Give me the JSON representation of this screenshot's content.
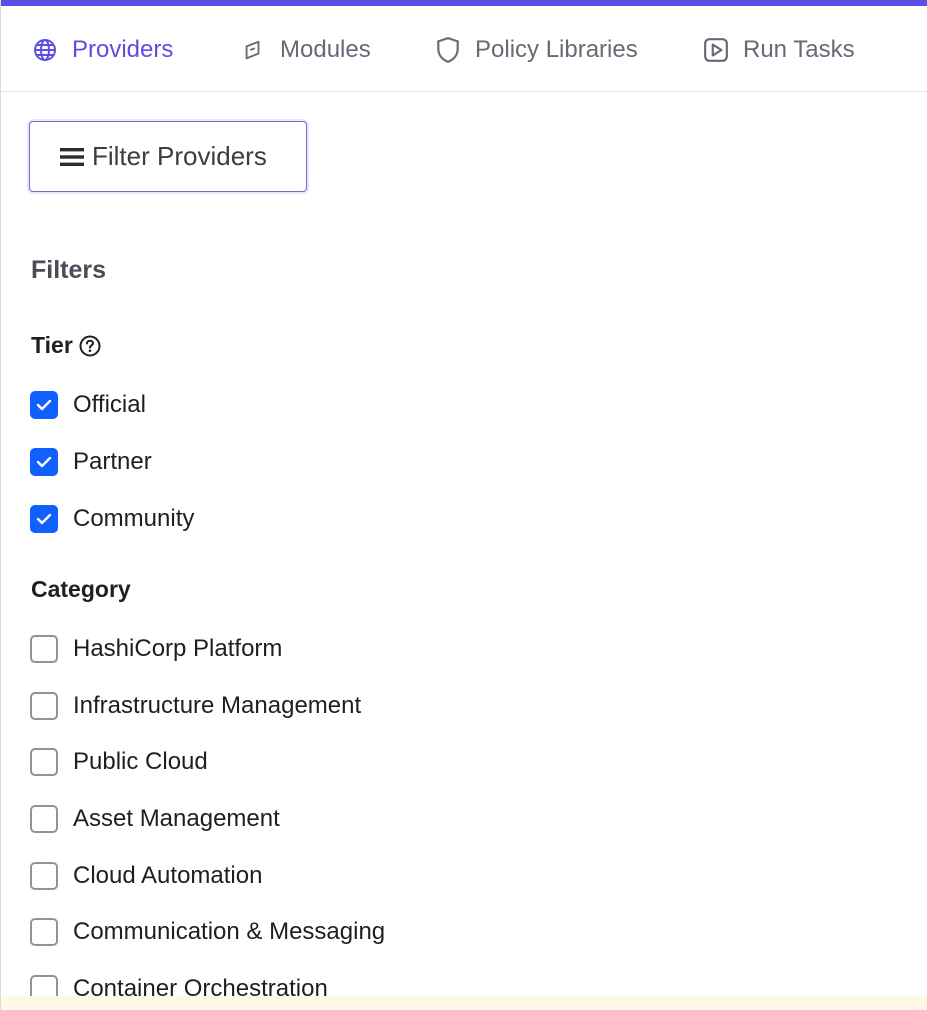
{
  "colors": {
    "accent": "#5c4ee5",
    "checkbox_checked": "#1060ff",
    "tab_inactive": "#656a76"
  },
  "tabs": [
    {
      "label": "Providers",
      "icon": "globe-icon",
      "active": true
    },
    {
      "label": "Modules",
      "icon": "module-icon",
      "active": false
    },
    {
      "label": "Policy Libraries",
      "icon": "shield-icon",
      "active": false
    },
    {
      "label": "Run Tasks",
      "icon": "play-square-icon",
      "active": false
    }
  ],
  "filter_button": {
    "label": "Filter Providers",
    "icon": "menu-icon"
  },
  "filters": {
    "heading": "Filters",
    "tier": {
      "title": "Tier",
      "help_icon": "question-circle-icon",
      "options": [
        {
          "label": "Official",
          "checked": true
        },
        {
          "label": "Partner",
          "checked": true
        },
        {
          "label": "Community",
          "checked": true
        }
      ]
    },
    "category": {
      "title": "Category",
      "options": [
        {
          "label": "HashiCorp Platform",
          "checked": false
        },
        {
          "label": "Infrastructure Management",
          "checked": false
        },
        {
          "label": "Public Cloud",
          "checked": false
        },
        {
          "label": "Asset Management",
          "checked": false
        },
        {
          "label": "Cloud Automation",
          "checked": false
        },
        {
          "label": "Communication & Messaging",
          "checked": false
        },
        {
          "label": "Container Orchestration",
          "checked": false
        }
      ]
    }
  }
}
